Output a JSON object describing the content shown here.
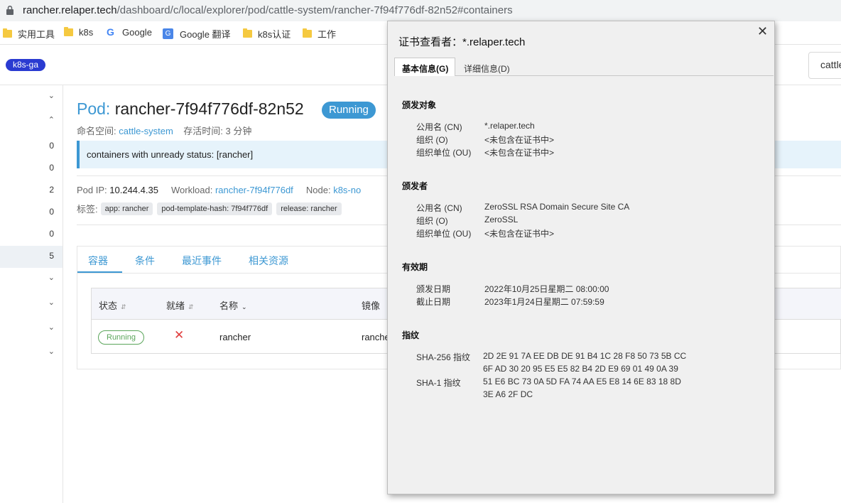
{
  "browser": {
    "url_host": "rancher.relaper.tech",
    "url_path": "/dashboard/c/local/explorer/pod/cattle-system/rancher-7f94f776df-82n52#containers",
    "bookmarks": [
      {
        "label": "实用工具",
        "icon": "folder-icon"
      },
      {
        "label": "k8s",
        "icon": "folder-icon"
      },
      {
        "label": "Google",
        "icon": "google-icon"
      },
      {
        "label": "Google 翻译",
        "icon": "google-translate-icon"
      },
      {
        "label": "k8s认证",
        "icon": "folder-icon"
      },
      {
        "label": "工作",
        "icon": "folder-icon"
      }
    ]
  },
  "header": {
    "cluster_badge": "k8s-ga",
    "search_text": "cattle"
  },
  "sidebar": {
    "rows": [
      "",
      "",
      "0",
      "0",
      "2",
      "0",
      "0",
      "5",
      "",
      "",
      "",
      ""
    ]
  },
  "pod": {
    "prefix": "Pod:",
    "name": "rancher-7f94f776df-82n52",
    "status": "Running",
    "namespace_label": "命名空间:",
    "namespace": "cattle-system",
    "age_label": "存活时间:",
    "age": "3 分钟",
    "banner": "containers with unready status: [rancher]",
    "ip_label": "Pod IP:",
    "ip": "10.244.4.35",
    "workload_label": "Workload:",
    "workload": "rancher-7f94f776df",
    "node_label": "Node:",
    "node": "k8s-no",
    "labels_label": "标签:",
    "labels": [
      "app: rancher",
      "pod-template-hash: 7f94f776df",
      "release: rancher"
    ]
  },
  "tabs": [
    "容器",
    "条件",
    "最近事件",
    "相关资源"
  ],
  "table": {
    "headers": [
      "状态",
      "就绪",
      "名称",
      "镜像"
    ],
    "row": {
      "status": "Running",
      "ready": "✕",
      "name": "rancher",
      "image": "rancher"
    }
  },
  "cert": {
    "title": "证书查看者：*.relaper.tech",
    "close": "✕",
    "tab_general": "基本信息(G)",
    "tab_details": "详细信息(D)",
    "subject_heading": "颁发对象",
    "subject": [
      {
        "label": "公用名 (CN)",
        "value": "*.relaper.tech"
      },
      {
        "label": "组织 (O)",
        "value": "<未包含在证书中>"
      },
      {
        "label": "组织单位 (OU)",
        "value": "<未包含在证书中>"
      }
    ],
    "issuer_heading": "颁发者",
    "issuer": [
      {
        "label": "公用名 (CN)",
        "value": "ZeroSSL RSA Domain Secure Site CA"
      },
      {
        "label": "组织 (O)",
        "value": "ZeroSSL"
      },
      {
        "label": "组织单位 (OU)",
        "value": "<未包含在证书中>"
      }
    ],
    "validity_heading": "有效期",
    "validity": [
      {
        "label": "颁发日期",
        "value": "2022年10月25日星期二 08:00:00"
      },
      {
        "label": "截止日期",
        "value": "2023年1月24日星期二 07:59:59"
      }
    ],
    "fingerprint_heading": "指纹",
    "sha256_label": "SHA-256 指纹",
    "sha256_line1": "2D 2E 91 7A EE DB DE 91 B4 1C 28 F8 50 73 5B CC",
    "sha256_line2": "6F AD 30 20 95 E5 E5 82 B4 2D E9 69 01 49 0A 39",
    "sha1_label": "SHA-1 指纹",
    "sha1_line1": "51 E6 BC 73 0A 5D FA 74 AA E5 E8 14 6E 83 18 8D",
    "sha1_line2": "3E A6 2F DC"
  }
}
